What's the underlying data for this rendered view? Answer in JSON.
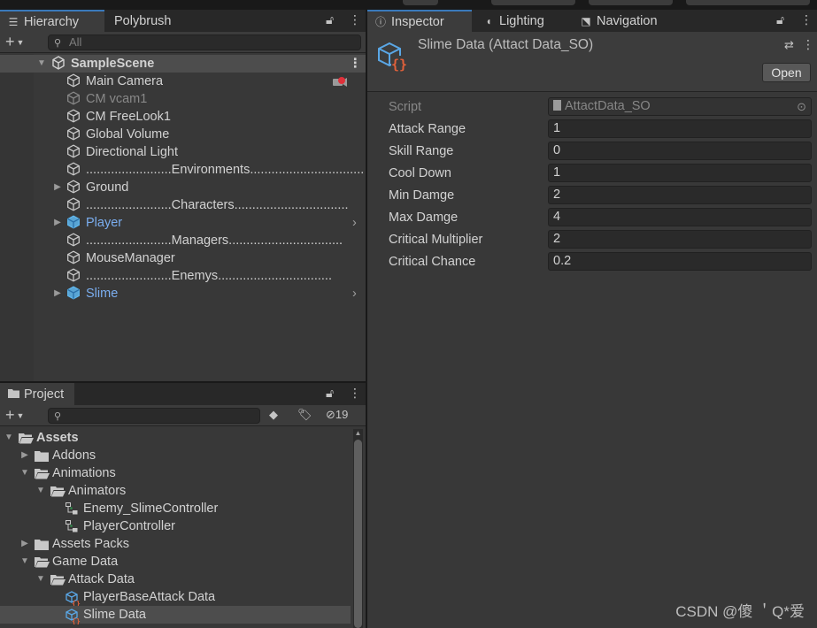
{
  "hierarchy": {
    "tabs": [
      "Hierarchy",
      "Polybrush"
    ],
    "search_placeholder": "All",
    "scene": "SampleScene",
    "items": [
      {
        "label": "Main Camera",
        "style": "normal",
        "has_children": false,
        "badge": "camera-warning"
      },
      {
        "label": "CM vcam1",
        "style": "dim",
        "has_children": false
      },
      {
        "label": "CM FreeLook1",
        "style": "normal",
        "has_children": false
      },
      {
        "label": "Global Volume",
        "style": "normal",
        "has_children": false
      },
      {
        "label": "Directional Light",
        "style": "normal",
        "has_children": false
      },
      {
        "label": "........................Environments................................",
        "style": "normal",
        "has_children": false
      },
      {
        "label": "Ground",
        "style": "normal",
        "has_children": true
      },
      {
        "label": "........................Characters................................",
        "style": "normal",
        "has_children": false
      },
      {
        "label": "Player",
        "style": "prefab",
        "has_children": true
      },
      {
        "label": "........................Managers................................",
        "style": "normal",
        "has_children": false
      },
      {
        "label": "MouseManager",
        "style": "normal",
        "has_children": false
      },
      {
        "label": "........................Enemys................................",
        "style": "normal",
        "has_children": false
      },
      {
        "label": "Slime",
        "style": "prefab",
        "has_children": true
      }
    ]
  },
  "project": {
    "tab": "Project",
    "hidden_count": "19",
    "tree": [
      {
        "label": "Assets",
        "kind": "folder-open",
        "depth": 0,
        "bold": true
      },
      {
        "label": "Addons",
        "kind": "folder",
        "depth": 1
      },
      {
        "label": "Animations",
        "kind": "folder-open",
        "depth": 1
      },
      {
        "label": "Animators",
        "kind": "folder-open",
        "depth": 2
      },
      {
        "label": "Enemy_SlimeController",
        "kind": "animator",
        "depth": 3
      },
      {
        "label": "PlayerController",
        "kind": "animator",
        "depth": 3
      },
      {
        "label": "Assets Packs",
        "kind": "folder",
        "depth": 1
      },
      {
        "label": "Game Data",
        "kind": "folder-open",
        "depth": 1
      },
      {
        "label": "Attack Data",
        "kind": "folder-open",
        "depth": 2
      },
      {
        "label": "PlayerBaseAttack Data",
        "kind": "scriptable",
        "depth": 3
      },
      {
        "label": "Slime Data",
        "kind": "scriptable",
        "depth": 3,
        "selected": true
      }
    ]
  },
  "inspector": {
    "tabs": [
      "Inspector",
      "Lighting",
      "Navigation"
    ],
    "title": "Slime Data (Attact Data_SO)",
    "open_label": "Open",
    "script_label": "Script",
    "script_value": "AttactData_SO",
    "fields": [
      {
        "label": "Attack Range",
        "value": "1"
      },
      {
        "label": "Skill Range",
        "value": "0"
      },
      {
        "label": "Cool Down",
        "value": "1"
      },
      {
        "label": "Min Damge",
        "value": "2"
      },
      {
        "label": "Max Damge",
        "value": "4"
      },
      {
        "label": "Critical Multiplier",
        "value": "2"
      },
      {
        "label": "Critical Chance",
        "value": "0.2"
      }
    ]
  },
  "watermark": "CSDN @傻 ＇Q*爱",
  "colors": {
    "accent": "#3a79bb",
    "prefab": "#7baef0",
    "panel": "#383838"
  }
}
